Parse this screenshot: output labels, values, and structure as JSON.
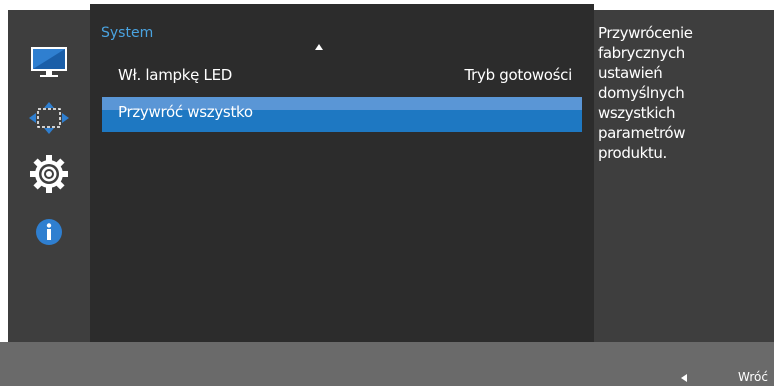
{
  "sidebar": {
    "icons": [
      "monitor-icon",
      "move-arrows-icon",
      "gear-icon",
      "info-icon"
    ]
  },
  "panel": {
    "title": "System",
    "items": [
      {
        "label": "Wł. lampkę LED",
        "value": "Tryb gotowości"
      },
      {
        "label": "Przywróć wszystko",
        "value": ""
      }
    ]
  },
  "info": {
    "lines": [
      "Przywrócenie",
      "fabrycznych",
      "ustawień",
      "domyślnych",
      "wszystkich",
      "parametrów",
      "produktu."
    ]
  },
  "footer": {
    "back_label": "Wróć"
  },
  "colors": {
    "accent": "#1e78c2",
    "title": "#4aa3e0"
  }
}
